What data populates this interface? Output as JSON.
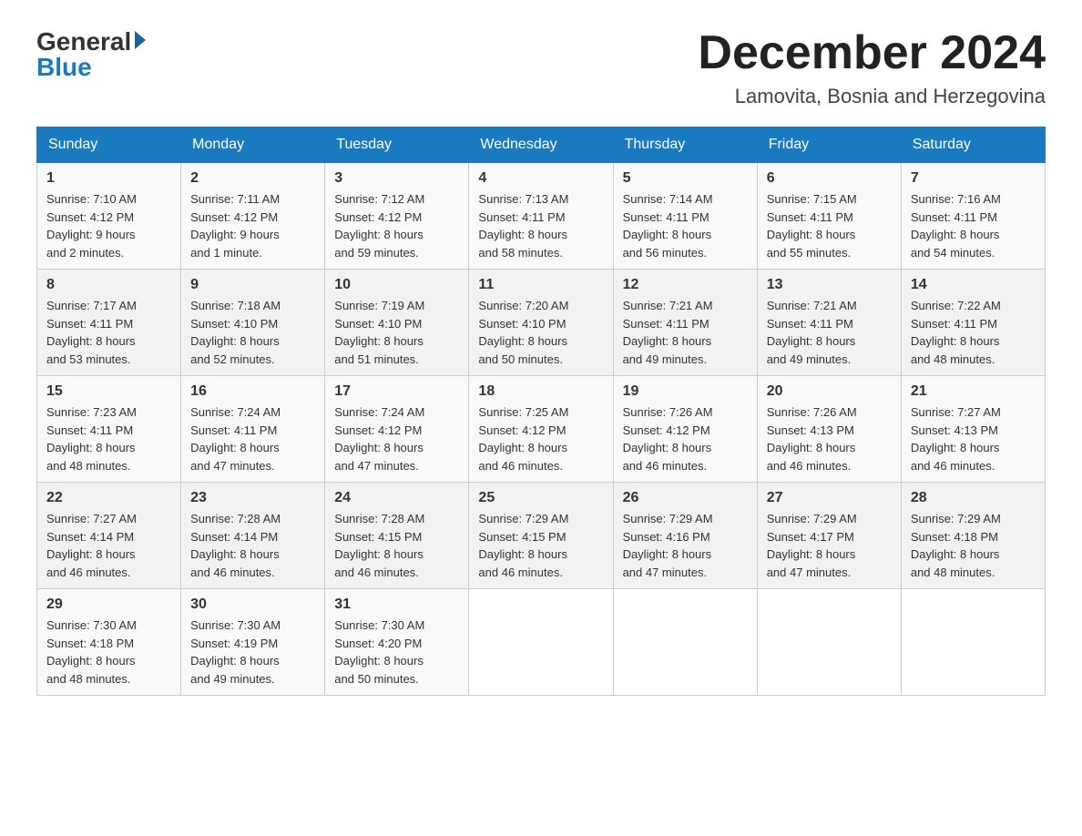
{
  "logo": {
    "general": "General",
    "blue": "Blue"
  },
  "title": "December 2024",
  "subtitle": "Lamovita, Bosnia and Herzegovina",
  "days_of_week": [
    "Sunday",
    "Monday",
    "Tuesday",
    "Wednesday",
    "Thursday",
    "Friday",
    "Saturday"
  ],
  "weeks": [
    [
      {
        "day": "1",
        "sunrise": "7:10 AM",
        "sunset": "4:12 PM",
        "daylight": "9 hours and 2 minutes."
      },
      {
        "day": "2",
        "sunrise": "7:11 AM",
        "sunset": "4:12 PM",
        "daylight": "9 hours and 1 minute."
      },
      {
        "day": "3",
        "sunrise": "7:12 AM",
        "sunset": "4:12 PM",
        "daylight": "8 hours and 59 minutes."
      },
      {
        "day": "4",
        "sunrise": "7:13 AM",
        "sunset": "4:11 PM",
        "daylight": "8 hours and 58 minutes."
      },
      {
        "day": "5",
        "sunrise": "7:14 AM",
        "sunset": "4:11 PM",
        "daylight": "8 hours and 56 minutes."
      },
      {
        "day": "6",
        "sunrise": "7:15 AM",
        "sunset": "4:11 PM",
        "daylight": "8 hours and 55 minutes."
      },
      {
        "day": "7",
        "sunrise": "7:16 AM",
        "sunset": "4:11 PM",
        "daylight": "8 hours and 54 minutes."
      }
    ],
    [
      {
        "day": "8",
        "sunrise": "7:17 AM",
        "sunset": "4:11 PM",
        "daylight": "8 hours and 53 minutes."
      },
      {
        "day": "9",
        "sunrise": "7:18 AM",
        "sunset": "4:10 PM",
        "daylight": "8 hours and 52 minutes."
      },
      {
        "day": "10",
        "sunrise": "7:19 AM",
        "sunset": "4:10 PM",
        "daylight": "8 hours and 51 minutes."
      },
      {
        "day": "11",
        "sunrise": "7:20 AM",
        "sunset": "4:10 PM",
        "daylight": "8 hours and 50 minutes."
      },
      {
        "day": "12",
        "sunrise": "7:21 AM",
        "sunset": "4:11 PM",
        "daylight": "8 hours and 49 minutes."
      },
      {
        "day": "13",
        "sunrise": "7:21 AM",
        "sunset": "4:11 PM",
        "daylight": "8 hours and 49 minutes."
      },
      {
        "day": "14",
        "sunrise": "7:22 AM",
        "sunset": "4:11 PM",
        "daylight": "8 hours and 48 minutes."
      }
    ],
    [
      {
        "day": "15",
        "sunrise": "7:23 AM",
        "sunset": "4:11 PM",
        "daylight": "8 hours and 48 minutes."
      },
      {
        "day": "16",
        "sunrise": "7:24 AM",
        "sunset": "4:11 PM",
        "daylight": "8 hours and 47 minutes."
      },
      {
        "day": "17",
        "sunrise": "7:24 AM",
        "sunset": "4:12 PM",
        "daylight": "8 hours and 47 minutes."
      },
      {
        "day": "18",
        "sunrise": "7:25 AM",
        "sunset": "4:12 PM",
        "daylight": "8 hours and 46 minutes."
      },
      {
        "day": "19",
        "sunrise": "7:26 AM",
        "sunset": "4:12 PM",
        "daylight": "8 hours and 46 minutes."
      },
      {
        "day": "20",
        "sunrise": "7:26 AM",
        "sunset": "4:13 PM",
        "daylight": "8 hours and 46 minutes."
      },
      {
        "day": "21",
        "sunrise": "7:27 AM",
        "sunset": "4:13 PM",
        "daylight": "8 hours and 46 minutes."
      }
    ],
    [
      {
        "day": "22",
        "sunrise": "7:27 AM",
        "sunset": "4:14 PM",
        "daylight": "8 hours and 46 minutes."
      },
      {
        "day": "23",
        "sunrise": "7:28 AM",
        "sunset": "4:14 PM",
        "daylight": "8 hours and 46 minutes."
      },
      {
        "day": "24",
        "sunrise": "7:28 AM",
        "sunset": "4:15 PM",
        "daylight": "8 hours and 46 minutes."
      },
      {
        "day": "25",
        "sunrise": "7:29 AM",
        "sunset": "4:15 PM",
        "daylight": "8 hours and 46 minutes."
      },
      {
        "day": "26",
        "sunrise": "7:29 AM",
        "sunset": "4:16 PM",
        "daylight": "8 hours and 47 minutes."
      },
      {
        "day": "27",
        "sunrise": "7:29 AM",
        "sunset": "4:17 PM",
        "daylight": "8 hours and 47 minutes."
      },
      {
        "day": "28",
        "sunrise": "7:29 AM",
        "sunset": "4:18 PM",
        "daylight": "8 hours and 48 minutes."
      }
    ],
    [
      {
        "day": "29",
        "sunrise": "7:30 AM",
        "sunset": "4:18 PM",
        "daylight": "8 hours and 48 minutes."
      },
      {
        "day": "30",
        "sunrise": "7:30 AM",
        "sunset": "4:19 PM",
        "daylight": "8 hours and 49 minutes."
      },
      {
        "day": "31",
        "sunrise": "7:30 AM",
        "sunset": "4:20 PM",
        "daylight": "8 hours and 50 minutes."
      },
      null,
      null,
      null,
      null
    ]
  ],
  "labels": {
    "sunrise": "Sunrise:",
    "sunset": "Sunset:",
    "daylight": "Daylight:"
  }
}
